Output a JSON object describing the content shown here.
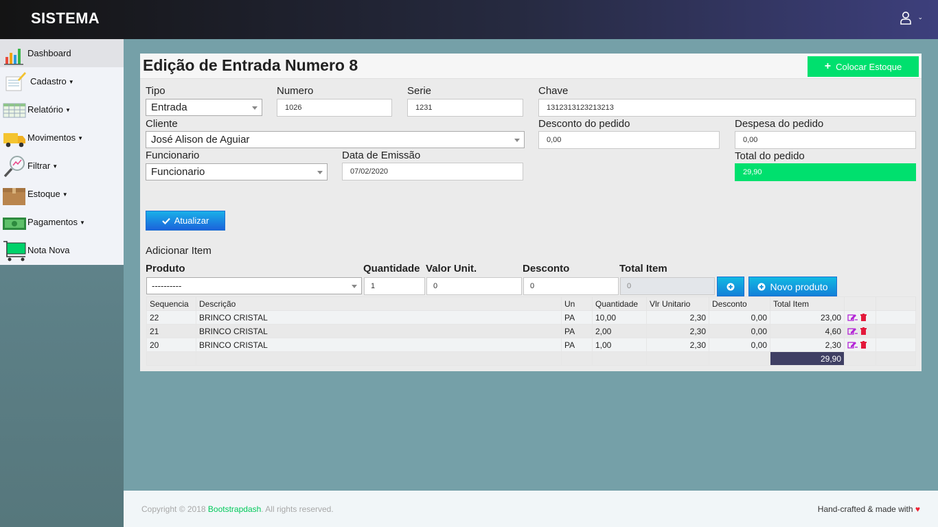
{
  "app": {
    "title": "SISTEMA"
  },
  "colors": {
    "accent_green": "#00e06e",
    "topbar_start": "#141414",
    "topbar_end": "#3d3f7c",
    "main_bg": "#75a0a8",
    "total_bg": "#3f3f63"
  },
  "sidebar": {
    "items": [
      {
        "label": "Dashboard",
        "icon": "bar-chart-icon",
        "dropdown": false
      },
      {
        "label": "Cadastro",
        "icon": "notepad-icon",
        "dropdown": true
      },
      {
        "label": "Relatório",
        "icon": "spreadsheet-icon",
        "dropdown": true
      },
      {
        "label": "Movimentos",
        "icon": "truck-icon",
        "dropdown": true
      },
      {
        "label": "Filtrar",
        "icon": "magnifier-icon",
        "dropdown": true
      },
      {
        "label": "Estoque",
        "icon": "box-icon",
        "dropdown": true
      },
      {
        "label": "Pagamentos",
        "icon": "money-icon",
        "dropdown": true
      },
      {
        "label": "Nota Nova",
        "icon": "cart-icon",
        "dropdown": false
      }
    ]
  },
  "page": {
    "title": "Edição de Entrada Numero 8",
    "colocar_estoque": "Colocar Estoque"
  },
  "form": {
    "tipo": {
      "label": "Tipo",
      "value": "Entrada"
    },
    "numero": {
      "label": "Numero",
      "value": "1026"
    },
    "serie": {
      "label": "Serie",
      "value": "1231"
    },
    "chave": {
      "label": "Chave",
      "value": "1312313123213213"
    },
    "cliente": {
      "label": "Cliente",
      "value": "José Alison de Aguiar"
    },
    "desconto_pedido": {
      "label": "Desconto do pedido",
      "value": "0,00"
    },
    "despesa_pedido": {
      "label": "Despesa do pedido",
      "value": "0,00"
    },
    "funcionario": {
      "label": "Funcionario",
      "value": "Funcionario"
    },
    "data_emissao": {
      "label": "Data de Emissão",
      "value": "07/02/2020"
    },
    "total_pedido": {
      "label": "Total do pedido",
      "value": "29,90"
    },
    "atualizar": "Atualizar"
  },
  "add_item": {
    "title": "Adicionar Item",
    "produto": {
      "label": "Produto",
      "value": "----------"
    },
    "quantidade": {
      "label": "Quantidade",
      "value": "1"
    },
    "valor_unit": {
      "label": "Valor Unit.",
      "value": "0"
    },
    "desconto": {
      "label": "Desconto",
      "value": "0"
    },
    "total_item": {
      "label": "Total Item",
      "value": "0"
    },
    "novo_produto": "Novo produto"
  },
  "table": {
    "headers": [
      "Sequencia",
      "Descrição",
      "Un",
      "Quantidade",
      "Vlr Unitario",
      "Desconto",
      "Total Item"
    ],
    "rows": [
      {
        "seq": "22",
        "desc": "BRINCO CRISTAL",
        "un": "PA",
        "qtd": "10,00",
        "vlr": "2,30",
        "desc_v": "0,00",
        "total": "23,00"
      },
      {
        "seq": "21",
        "desc": "BRINCO CRISTAL",
        "un": "PA",
        "qtd": "2,00",
        "vlr": "2,30",
        "desc_v": "0,00",
        "total": "4,60"
      },
      {
        "seq": "20",
        "desc": "BRINCO CRISTAL",
        "un": "PA",
        "qtd": "1,00",
        "vlr": "2,30",
        "desc_v": "0,00",
        "total": "2,30"
      }
    ],
    "grand_total": "29,90"
  },
  "footer": {
    "copyright_prefix": "Copyright © 2018 ",
    "link": "Bootstrapdash",
    "copyright_suffix": ". All rights reserved.",
    "right": "Hand-crafted & made with"
  }
}
